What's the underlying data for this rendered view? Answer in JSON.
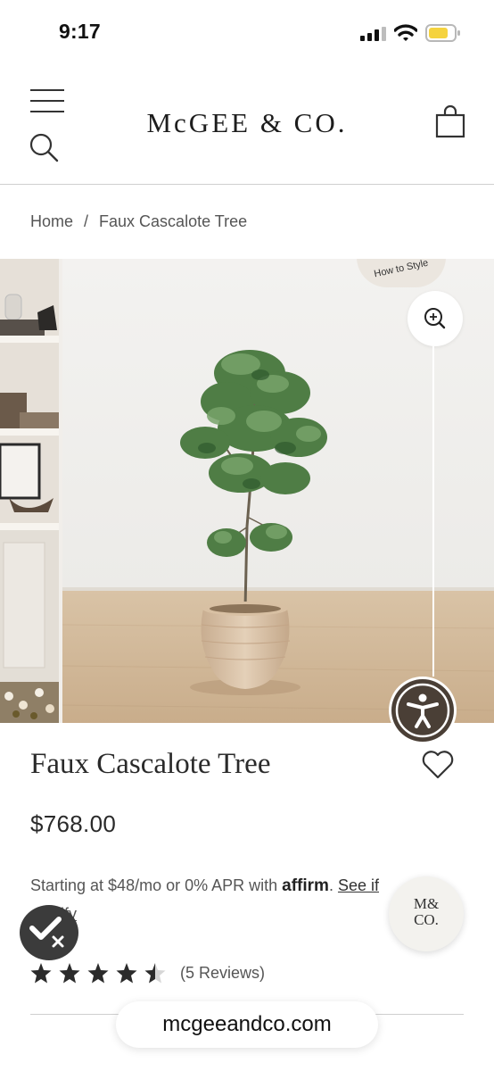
{
  "status_bar": {
    "time": "9:17"
  },
  "header": {
    "logo": "McGEE & CO."
  },
  "breadcrumb": {
    "home": "Home",
    "separator": "/",
    "current": "Faux Cascalote Tree"
  },
  "gallery": {
    "how_to_style": "How to Style"
  },
  "product": {
    "title": "Faux Cascalote Tree",
    "price": "$768.00",
    "financing_prefix": "Starting at $48/mo or 0% APR with",
    "affirm": "affirm",
    "see_if": "See if",
    "qualify": "qualify",
    "rating": 4.5,
    "reviews": "(5 Reviews)"
  },
  "badge": {
    "line1": "M&",
    "line2": "CO."
  },
  "browser": {
    "url": "mcgeeandco.com"
  },
  "colors": {
    "accent_dark": "#4a3f36",
    "battery": "#f5d33f"
  }
}
